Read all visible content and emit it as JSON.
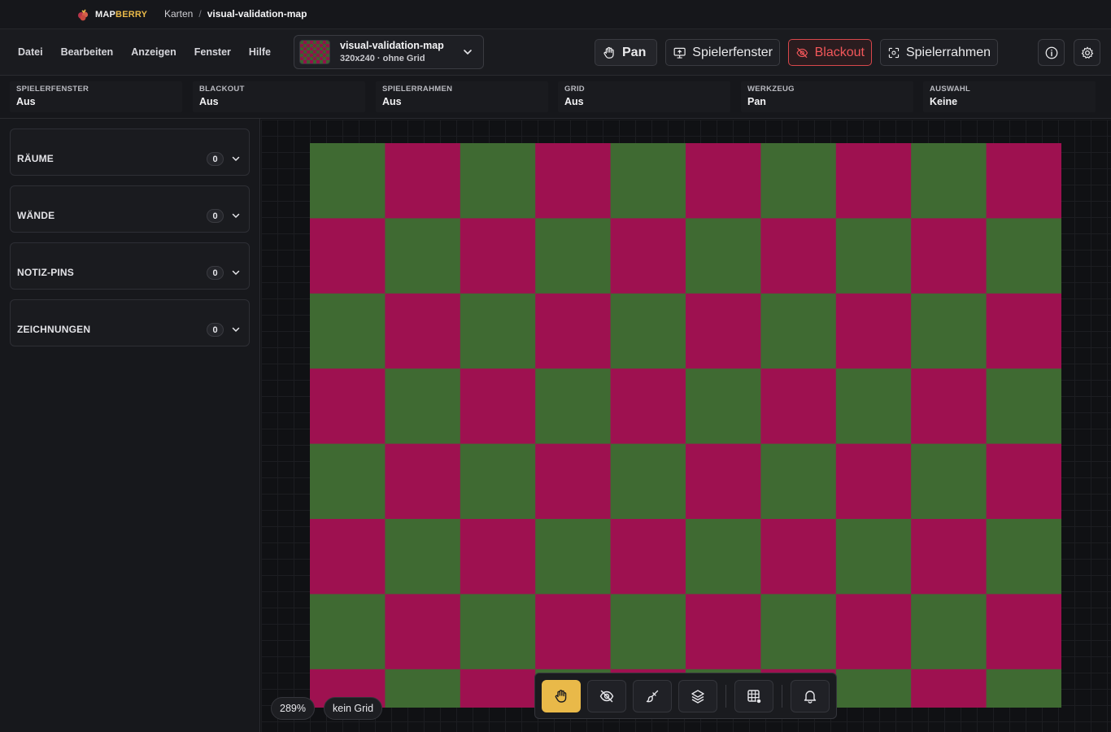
{
  "app": {
    "brand_part1": "MAP",
    "brand_part2": "BERRY",
    "breadcrumb_root": "Karten",
    "breadcrumb_sep": "/",
    "breadcrumb_current": "visual-validation-map"
  },
  "menu": [
    "Datei",
    "Bearbeiten",
    "Anzeigen",
    "Fenster",
    "Hilfe"
  ],
  "map_selector": {
    "title": "visual-validation-map",
    "subtitle": "320x240 · ohne Grid"
  },
  "toolbar": {
    "pan_label": "Pan",
    "spielerfenster_label": "Spielerfenster",
    "blackout_label": "Blackout",
    "spielerrahmen_label": "Spielerrahmen",
    "accent": "#e9b949",
    "danger": "#f2575a"
  },
  "status": [
    {
      "label": "SPIELERFENSTER",
      "value": "Aus"
    },
    {
      "label": "BLACKOUT",
      "value": "Aus"
    },
    {
      "label": "SPIELERRAHMEN",
      "value": "Aus"
    },
    {
      "label": "GRID",
      "value": "Aus"
    },
    {
      "label": "WERKZEUG",
      "value": "Pan"
    },
    {
      "label": "AUSWAHL",
      "value": "Keine"
    }
  ],
  "sidebar": {
    "panels": [
      {
        "title": "RÄUME",
        "count": "0"
      },
      {
        "title": "WÄNDE",
        "count": "0"
      },
      {
        "title": "NOTIZ-PINS",
        "count": "0"
      },
      {
        "title": "ZEICHNUNGEN",
        "count": "0"
      }
    ]
  },
  "canvas": {
    "zoom": "289%",
    "grid_label": "kein Grid",
    "checker_colors": [
      "#9e1150",
      "#3f6a32"
    ]
  },
  "dock": {
    "tools": [
      "hand-icon",
      "eye-off-icon",
      "brush-icon",
      "layers-icon",
      "grid-icon",
      "bell-icon"
    ],
    "active_tool": "hand-icon"
  }
}
